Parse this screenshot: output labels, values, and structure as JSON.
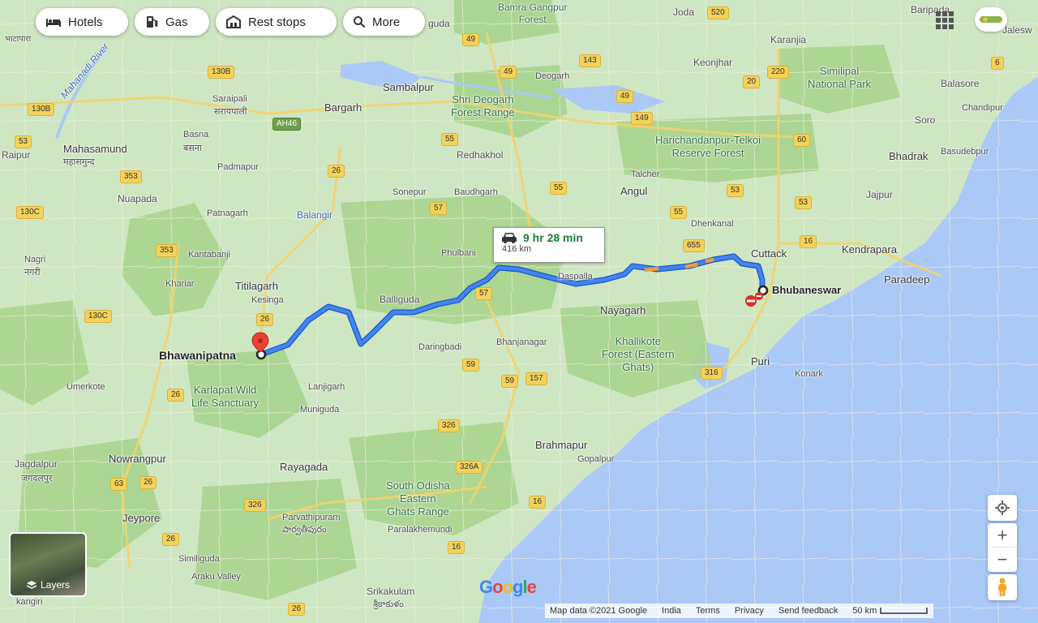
{
  "toolbar": {
    "hotels": "Hotels",
    "gas": "Gas",
    "rest_stops": "Rest stops",
    "more": "More"
  },
  "route": {
    "duration": "9 hr 28 min",
    "distance": "416 km",
    "origin": "Bhawanipatna",
    "destination": "Bhubaneswar"
  },
  "places": {
    "bamra_gangpur_forest": "Bamra Gangpur\nForest",
    "joda": "Joda",
    "baripada": "Baripada",
    "jalesw": "Jalesw",
    "bhatapara": "भाटापारा",
    "karanjia": "Karanjia",
    "keonjhar": "Keonjhar",
    "simlipal": "Similipal\nNational Park",
    "balasore": "Balasore",
    "chandipur": "Chandipur",
    "deogarh": "Deogarh",
    "sambalpur": "Sambalpur",
    "mahanadi_river": "Mahanadi River",
    "saraipali": "Saraipali",
    "saraipali_hi": "सरायपाली",
    "bargarh": "Bargarh",
    "shri_deogarh": "Shri Deogarh\nForest Range",
    "harichandanpur": "Harichandanpur-Telkoi\nReserve Forest",
    "soro": "Soro",
    "raipur": "Raipur",
    "basna": "Basna",
    "basna_hi": "बसना",
    "mahasamund": "Mahasamund",
    "mahasamund_hi": "महासमुन्द",
    "redhakhol": "Redhakhol",
    "bhadrak": "Bhadrak",
    "basudebpur": "Basudebpur",
    "padmapur": "Padmapur",
    "talcher": "Talcher",
    "angul": "Angul",
    "jajpur": "Jajpur",
    "nuapada": "Nuapada",
    "sonepur": "Sonepur",
    "baudhgarh": "Baudhgarh",
    "patnagarh": "Patnagarh",
    "balangir": "Balangir",
    "dhenkanal": "Dhenkanal",
    "kendrapara": "Kendrapara",
    "kantabanji": "Kantabanji",
    "phulbani": "Phulbani",
    "cuttack": "Cuttack",
    "nagri": "Nagri",
    "nagri_hi": "नगरी",
    "daspalla": "Daspalla",
    "paradeep": "Paradeep",
    "khariar": "Khariar",
    "titilagarh": "Titilagarh",
    "balliguda": "Balliguda",
    "kesinga": "Kesinga",
    "nayagarh": "Nayagarh",
    "khallikote": "Khallikote\nForest (Eastern\nGhats)",
    "daringbadi": "Daringbadi",
    "bhanjanagar": "Bhanjanagar",
    "puri": "Puri",
    "karlapat": "Karlapat Wild\nLife Sanctuary",
    "umerkote": "Umerkote",
    "lanjigarh": "Lanjigarh",
    "konark": "Konark",
    "muniguda": "Muniguda",
    "brahmapur": "Brahmapur",
    "jagdalpur": "Jagdalpur",
    "jagdalpur_hi": "जगदलपुर",
    "nowrangpur": "Nowrangpur",
    "rayagada": "Rayagada",
    "gopalpur": "Gopalpur",
    "south_odisha": "South Odisha\nEastern\nGhats Range",
    "jeypore": "Jeypore",
    "parvathipuram": "Parvathipuram",
    "parvathipuram_te": "పార్వతీపురం",
    "paralakhemundi": "Paralakhemundi",
    "simliguda": "Similiguda",
    "araku": "Araku Valley",
    "srikakulam": "Srikakulam",
    "srikakulam_te": "శ్రీకాకుళం",
    "kangiri": "kangiri",
    "guda": "guda"
  },
  "shields": [
    {
      "id": "49a",
      "label": "49"
    },
    {
      "id": "520",
      "label": "520"
    },
    {
      "id": "143",
      "label": "143"
    },
    {
      "id": "49b",
      "label": "49"
    },
    {
      "id": "20",
      "label": "20"
    },
    {
      "id": "220",
      "label": "220"
    },
    {
      "id": "6a",
      "label": "6"
    },
    {
      "id": "130b",
      "label": "130B"
    },
    {
      "id": "130b2",
      "label": "130B"
    },
    {
      "id": "49c",
      "label": "49"
    },
    {
      "id": "149",
      "label": "149"
    },
    {
      "id": "ah46",
      "label": "AH46"
    },
    {
      "id": "53a",
      "label": "53"
    },
    {
      "id": "55a",
      "label": "55"
    },
    {
      "id": "60",
      "label": "60"
    },
    {
      "id": "353a",
      "label": "353"
    },
    {
      "id": "26a",
      "label": "26"
    },
    {
      "id": "55b",
      "label": "55"
    },
    {
      "id": "53b",
      "label": "53"
    },
    {
      "id": "130c",
      "label": "130C"
    },
    {
      "id": "57a",
      "label": "57"
    },
    {
      "id": "55c",
      "label": "55"
    },
    {
      "id": "53c",
      "label": "53"
    },
    {
      "id": "16a",
      "label": "16"
    },
    {
      "id": "353b",
      "label": "353"
    },
    {
      "id": "655",
      "label": "655"
    },
    {
      "id": "57b",
      "label": "57"
    },
    {
      "id": "130c2",
      "label": "130C"
    },
    {
      "id": "26b",
      "label": "26"
    },
    {
      "id": "59a",
      "label": "59"
    },
    {
      "id": "59b",
      "label": "59"
    },
    {
      "id": "157",
      "label": "157"
    },
    {
      "id": "316",
      "label": "316"
    },
    {
      "id": "26c",
      "label": "26"
    },
    {
      "id": "326a",
      "label": "326"
    },
    {
      "id": "326a2",
      "label": "326A"
    },
    {
      "id": "63",
      "label": "63"
    },
    {
      "id": "26d",
      "label": "26"
    },
    {
      "id": "326b",
      "label": "326"
    },
    {
      "id": "26e",
      "label": "26"
    },
    {
      "id": "16b",
      "label": "16"
    },
    {
      "id": "26f",
      "label": "26"
    },
    {
      "id": "16c",
      "label": "16"
    }
  ],
  "map_controls": {
    "layers": "Layers",
    "zoom_in": "+",
    "zoom_out": "−"
  },
  "attribution": {
    "map_data": "Map data ©2021 Google",
    "india": "India",
    "terms": "Terms",
    "privacy": "Privacy",
    "feedback": "Send feedback",
    "scale": "50 km"
  },
  "logo": {
    "G": "G",
    "o1": "o",
    "o2": "o",
    "g": "g",
    "l": "l",
    "e": "e"
  },
  "colors": {
    "route": "#4285f4",
    "route_border": "#1a56c4",
    "traffic": "#f29c38",
    "land": "#cfe6c3",
    "forest": "#a8d48e",
    "sea": "#aac9f7",
    "destination_pin": "#ea4335"
  }
}
